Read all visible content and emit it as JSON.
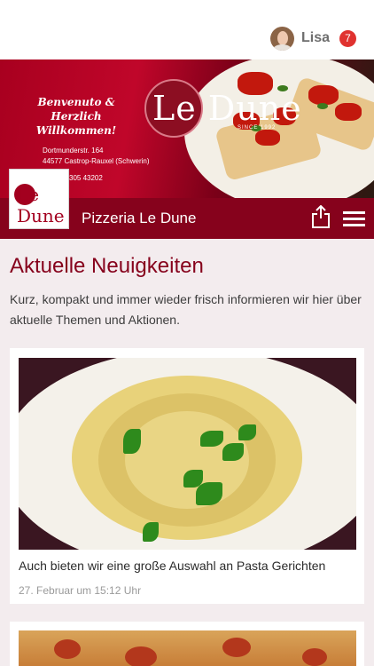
{
  "topbar": {
    "user_name": "Lisa",
    "notification_count": "7"
  },
  "banner": {
    "welcome_line1": "Benvenuto &",
    "welcome_line2": "Herzlich Willkommen!",
    "address_line1": "Dortmunderstr. 164",
    "address_line2": "44577 Castrop-Rauxel (Schwerin)",
    "phone": "305 43202",
    "brand": "Le Dune",
    "since": "SINCE 1992"
  },
  "navbar": {
    "title": "Pizzeria Le Dune",
    "logo_text": "Le Dune"
  },
  "main": {
    "section_title": "Aktuelle Neuigkeiten",
    "intro": "Kurz, kompakt und immer wieder frisch informieren wir hier über aktuelle Themen und Aktionen."
  },
  "posts": [
    {
      "title": "Auch bieten wir eine große Auswahl an Pasta Gerichten",
      "date": "27. Februar um 15:12 Uhr"
    }
  ],
  "icons": {
    "share": "share-icon",
    "menu": "hamburger-menu-icon"
  },
  "colors": {
    "brand": "#86021c",
    "badge": "#e0322f",
    "background": "#f3ecee"
  }
}
